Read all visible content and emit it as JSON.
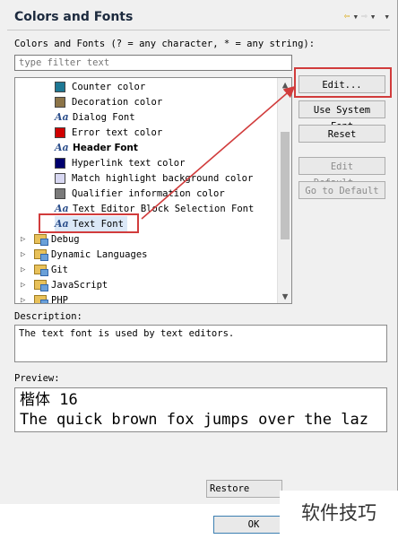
{
  "header": {
    "title": "Colors and Fonts",
    "nav": {
      "back_glyph": "⇦",
      "forward_glyph": "⇨",
      "dropdown_glyph": "▾"
    }
  },
  "filter": {
    "label": "Colors and Fonts (? = any character, * = any string):",
    "placeholder": "type filter text"
  },
  "tree": {
    "items": [
      {
        "label": "Counter color",
        "kind": "swatch",
        "color": "#1e7894"
      },
      {
        "label": "Decoration color",
        "kind": "swatch",
        "color": "#8c7448"
      },
      {
        "label": "Dialog Font",
        "kind": "font"
      },
      {
        "label": "Error text color",
        "kind": "swatch",
        "color": "#d00000"
      },
      {
        "label": "Header Font",
        "kind": "font",
        "bold": true
      },
      {
        "label": "Hyperlink text color",
        "kind": "swatch",
        "color": "#00006e"
      },
      {
        "label": "Match highlight background color",
        "kind": "swatch",
        "color": "#d8d8f2"
      },
      {
        "label": "Qualifier information color",
        "kind": "swatch",
        "color": "#7a7a7a"
      },
      {
        "label": "Text Editor Block Selection Font",
        "kind": "font"
      },
      {
        "label": "Text Font",
        "kind": "font",
        "selected": true
      },
      {
        "label": "Debug",
        "kind": "folder"
      },
      {
        "label": "Dynamic Languages",
        "kind": "folder"
      },
      {
        "label": "Git",
        "kind": "folder"
      },
      {
        "label": "JavaScript",
        "kind": "folder"
      },
      {
        "label": "PHP",
        "kind": "folder"
      }
    ],
    "font_icon": "Aa",
    "expand_glyph": "▷"
  },
  "buttons": {
    "edit": "Edit...",
    "use_system_font": "Use System Font",
    "reset": "Reset",
    "edit_default": "Edit Default...",
    "go_to_default": "Go to Default"
  },
  "description": {
    "label": "Description:",
    "text": "The text font is used by text editors."
  },
  "preview": {
    "label": "Preview:",
    "line1": "楷体 16",
    "line2": "The quick brown fox jumps over the laz"
  },
  "footer": {
    "restore_defaults": "Restore Defau",
    "ok": "OK"
  },
  "watermark": "软件技巧",
  "colors": {
    "annotation_red": "#d13c3c"
  }
}
